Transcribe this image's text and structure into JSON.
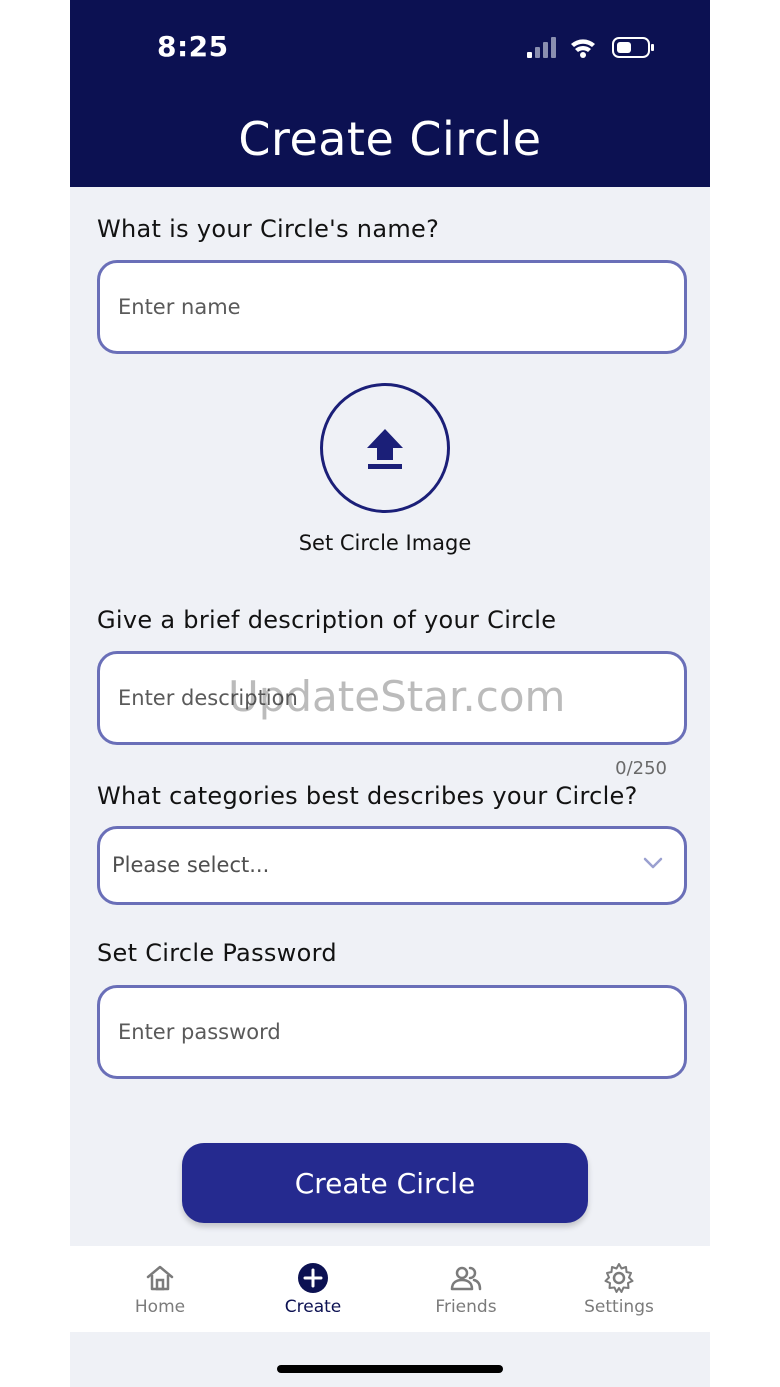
{
  "status_bar": {
    "time": "8:25"
  },
  "header": {
    "title": "Create Circle"
  },
  "form": {
    "name_label": "What is your Circle's name?",
    "name_placeholder": "Enter name",
    "image_label": "Set Circle Image",
    "description_label": "Give a brief description of your Circle",
    "description_placeholder": "Enter description",
    "description_counter": "0/250",
    "category_label": "What categories best describes your Circle?",
    "category_value": "Please select...",
    "password_label": "Set Circle Password",
    "password_placeholder": "Enter password",
    "submit_label": "Create Circle"
  },
  "tabbar": {
    "items": [
      {
        "label": "Home",
        "icon": "home-icon",
        "active": false
      },
      {
        "label": "Create",
        "icon": "plus-circle-icon",
        "active": true
      },
      {
        "label": "Friends",
        "icon": "people-icon",
        "active": false
      },
      {
        "label": "Settings",
        "icon": "gear-icon",
        "active": false
      }
    ]
  },
  "watermark": "UpdateStar.com",
  "colors": {
    "header_bg": "#0c1152",
    "accent": "#252a8f",
    "field_border": "#6a6fb8",
    "background": "#eff1f6"
  }
}
